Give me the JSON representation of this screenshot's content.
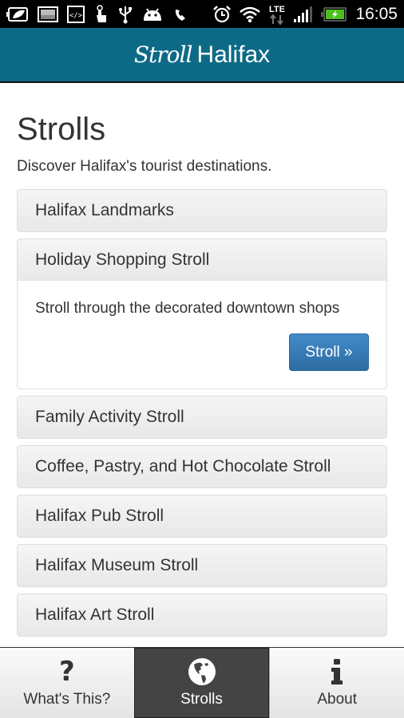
{
  "status_bar": {
    "time": "16:05",
    "network": "LTE",
    "left_icons": [
      "battery-saver-icon",
      "gallery-icon",
      "code-icon",
      "touch-icon",
      "usb-icon",
      "android-icon",
      "phone-icon"
    ],
    "right_icons": [
      "alarm-icon",
      "wifi-icon",
      "lte-icon",
      "signal-icon",
      "battery-charging-icon"
    ]
  },
  "app_bar": {
    "brand_script": "Stroll",
    "brand_main": "Halifax",
    "color": "#0d6a86"
  },
  "page": {
    "title": "Strolls",
    "description": "Discover Halifax's tourist destinations."
  },
  "strolls": [
    {
      "title": "Halifax Landmarks",
      "expanded": false
    },
    {
      "title": "Holiday Shopping Stroll",
      "expanded": true,
      "description": "Stroll through the decorated downtown shops",
      "button_label": "Stroll »"
    },
    {
      "title": "Family Activity Stroll",
      "expanded": false
    },
    {
      "title": "Coffee, Pastry, and Hot Chocolate Stroll",
      "expanded": false
    },
    {
      "title": "Halifax Pub Stroll",
      "expanded": false
    },
    {
      "title": "Halifax Museum Stroll",
      "expanded": false
    },
    {
      "title": "Halifax Art Stroll",
      "expanded": false
    }
  ],
  "tabs": [
    {
      "label": "What's This?",
      "icon": "question-icon",
      "active": false
    },
    {
      "label": "Strolls",
      "icon": "globe-icon",
      "active": true
    },
    {
      "label": "About",
      "icon": "info-icon",
      "active": false
    }
  ],
  "colors": {
    "primary_button": "#428bca",
    "active_tab": "#444444"
  }
}
